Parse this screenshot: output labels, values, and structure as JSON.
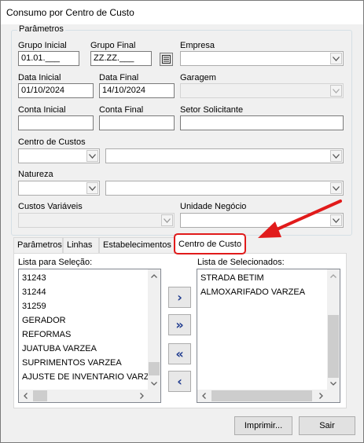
{
  "window": {
    "title": "Consumo por Centro de Custo"
  },
  "parametros": {
    "group_title": "Parâmetros",
    "grupo_inicial": {
      "label": "Grupo Inicial",
      "value": "01.01.___"
    },
    "grupo_final": {
      "label": "Grupo Final",
      "value": "ZZ.ZZ.___"
    },
    "empresa": {
      "label": "Empresa",
      "value": ""
    },
    "data_inicial": {
      "label": "Data Inicial",
      "value": "01/10/2024"
    },
    "data_final": {
      "label": "Data Final",
      "value": "14/10/2024"
    },
    "garagem": {
      "label": "Garagem",
      "value": ""
    },
    "conta_inicial": {
      "label": "Conta Inicial",
      "value": ""
    },
    "conta_final": {
      "label": "Conta Final",
      "value": ""
    },
    "setor_solicitante": {
      "label": "Setor Solicitante",
      "value": ""
    },
    "centro_de_custos": {
      "label": "Centro de Custos",
      "value": ""
    },
    "natureza": {
      "label": "Natureza",
      "value": ""
    },
    "custos_variaveis": {
      "label": "Custos Variáveis",
      "value": ""
    },
    "unidade_negocio": {
      "label": "Unidade Negócio",
      "value": ""
    }
  },
  "tabs": [
    {
      "label": "Parâmetros"
    },
    {
      "label": "Linhas"
    },
    {
      "label": "Estabelecimentos"
    },
    {
      "label": "Centro de Custo"
    }
  ],
  "active_tab": "Centro de Custo",
  "lista_selecao": {
    "label": "Lista para Seleção:",
    "items": [
      "31243",
      "31244",
      "31259",
      "GERADOR",
      "REFORMAS",
      "JUATUBA VARZEA",
      "SUPRIMENTOS VARZEA",
      "AJUSTE DE INVENTARIO VARZEA"
    ]
  },
  "lista_selecionados": {
    "label": "Lista de Selecionados:",
    "items": [
      "STRADA BETIM",
      "ALMOXARIFADO VARZEA"
    ]
  },
  "move_buttons": {
    "add_one": "›",
    "add_all": "»",
    "remove_all": "«",
    "remove_one": "‹"
  },
  "buttons": {
    "imprimir": "Imprimir...",
    "sair": "Sair"
  },
  "colors": {
    "annotation_red": "#e11b1b",
    "button_blue": "#1f3b8f"
  }
}
